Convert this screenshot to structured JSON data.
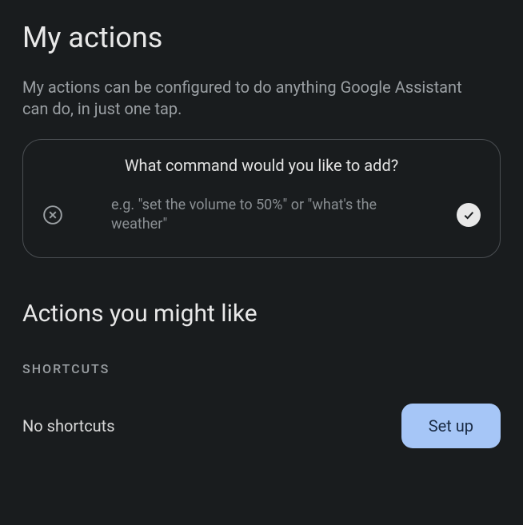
{
  "header": {
    "title": "My actions",
    "description": "My actions can be configured to do anything Google Assistant can do, in just one tap."
  },
  "command_card": {
    "prompt": "What command would you like to add?",
    "example": "e.g. \"set the volume to 50%\" or \"what's the weather\""
  },
  "suggestions": {
    "title": "Actions you might like",
    "shortcuts_label": "SHORTCUTS",
    "empty_text": "No shortcuts",
    "setup_button": "Set up"
  }
}
